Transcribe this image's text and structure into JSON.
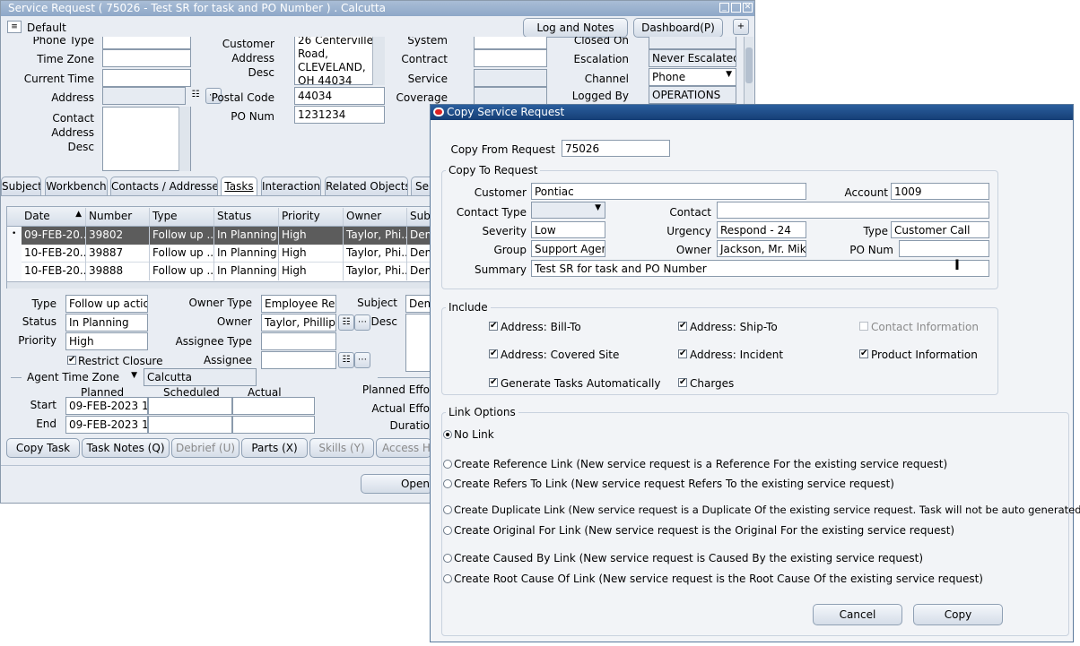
{
  "bg": {
    "title": "Service Request ( 75026 - Test SR for task and PO Number ) . Calcutta",
    "folder": "Default",
    "buttons": {
      "log_notes": "Log and Notes",
      "dashboard": "Dashboard(P)"
    },
    "header": {
      "phone_type_label": "Phone Type",
      "time_zone_label": "Time Zone",
      "current_time_label": "Current Time",
      "address_label": "Address",
      "contact_address_desc_label": "Contact\nAddress\nDesc",
      "customer_address_desc_label": "Customer\nAddress\nDesc",
      "customer_address_desc_value": "26 Centerville\nRoad,\nCLEVELAND,\nOH 44034",
      "postal_code_label": "Postal Code",
      "postal_code_value": "44034",
      "po_num_label": "PO Num",
      "po_num_value": "1231234",
      "system_label": "System",
      "contract_label": "Contract",
      "service_label": "Service",
      "coverage_label": "Coverage",
      "closed_on_label": "Closed On",
      "escalation_label": "Escalation",
      "escalation_value": "Never Escalated",
      "channel_label": "Channel",
      "channel_value": "Phone",
      "logged_by_label": "Logged By",
      "logged_by_value": "OPERATIONS"
    },
    "tabs": [
      "Subject",
      "Workbench",
      "Contacts / Addresses",
      "Tasks",
      "Interactions",
      "Related Objects",
      "Ser"
    ],
    "grid": {
      "columns": [
        "Date",
        "Number",
        "Type",
        "Status",
        "Priority",
        "Owner",
        "Subj"
      ],
      "rows": [
        [
          "09-FEB-20...",
          "39802",
          "Follow up ...",
          "In Planning",
          "High",
          "Taylor, Phi...",
          "Dem"
        ],
        [
          "10-FEB-20...",
          "39887",
          "Follow up ...",
          "In Planning",
          "High",
          "Taylor, Phi...",
          "Dem"
        ],
        [
          "10-FEB-20...",
          "39888",
          "Follow up ...",
          "In Planning",
          "High",
          "Taylor, Phi...",
          "Dem"
        ]
      ]
    },
    "detail": {
      "type_label": "Type",
      "type_value": "Follow up action",
      "status_label": "Status",
      "status_value": "In Planning",
      "priority_label": "Priority",
      "priority_value": "High",
      "restrict_closure_label": "Restrict Closure",
      "owner_type_label": "Owner Type",
      "owner_type_value": "Employee Reso",
      "owner_label": "Owner",
      "owner_value": "Taylor, Phillip C",
      "assignee_type_label": "Assignee Type",
      "assignee_label": "Assignee",
      "subject_label": "Subject",
      "subject_value": "Dem",
      "desc_label": "Desc",
      "agent_tz_value": "Agent Time Zone",
      "tz_city": "Calcutta",
      "planned_label": "Planned",
      "scheduled_label": "Scheduled",
      "actual_label": "Actual",
      "start_label": "Start",
      "start_value": "09-FEB-2023 12:",
      "end_label": "End",
      "end_value": "09-FEB-2023 12:",
      "planned_effort_label": "Planned Effo",
      "actual_effort_label": "Actual Effo",
      "duration_label": "Duratio"
    },
    "bottom_buttons": [
      "Copy Task",
      "Task Notes (Q)",
      "Debrief (U)",
      "Parts (X)",
      "Skills (Y)",
      "Access Ho"
    ],
    "open_button": "Open"
  },
  "dialog": {
    "title": "Copy Service Request",
    "copy_from_label": "Copy From Request",
    "copy_from_value": "75026",
    "copy_to_legend": "Copy To Request",
    "customer_label": "Customer",
    "customer_value": "Pontiac",
    "account_label": "Account",
    "account_value": "1009",
    "contact_type_label": "Contact Type",
    "contact_label": "Contact",
    "severity_label": "Severity",
    "severity_value": "Low",
    "urgency_label": "Urgency",
    "urgency_value": "Respond - 24",
    "type_label": "Type",
    "type_value": "Customer Call",
    "group_label": "Group",
    "group_value": "Support Agents",
    "owner_label": "Owner",
    "owner_value": "Jackson, Mr. Mike",
    "po_num_label": "PO Num",
    "summary_label": "Summary",
    "summary_value": "Test SR for task and PO Number",
    "include_legend": "Include",
    "include": {
      "bill_to": "Address: Bill-To",
      "ship_to": "Address: Ship-To",
      "contact_info": "Contact Information",
      "covered_site": "Address: Covered Site",
      "incident": "Address: Incident",
      "product_info": "Product Information",
      "gen_tasks": "Generate Tasks Automatically",
      "charges": "Charges"
    },
    "link_legend": "Link Options",
    "links": [
      "No Link",
      "Create Reference Link (New service request is a Reference For the existing service request)",
      "Create Refers To Link (New service request Refers To the existing service request)",
      "Create Duplicate Link (New service request is a Duplicate Of the existing service request. Task will not be auto generated)",
      "Create Original For Link (New service request is the Original For the existing service request)",
      "Create Caused By Link (New service request is Caused By the existing service request)",
      "Create Root Cause Of Link (New service request is the Root Cause Of the existing service request)"
    ],
    "cancel_label": "Cancel",
    "copy_label": "Copy"
  }
}
